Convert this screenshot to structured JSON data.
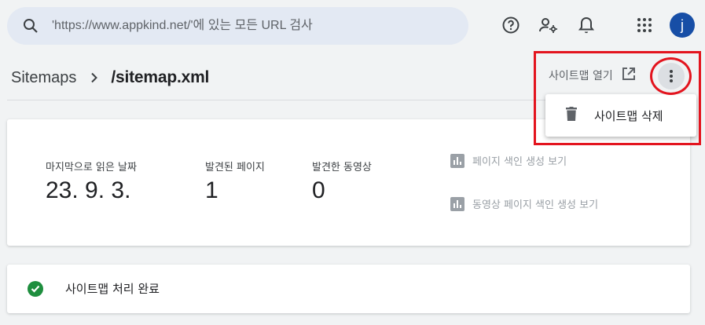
{
  "search": {
    "placeholder": "'https://www.appkind.net/'에 있는 모든 URL 검사"
  },
  "topbar": {
    "icons": [
      "help-icon",
      "manage-users-icon",
      "notifications-icon",
      "apps-grid-icon"
    ],
    "avatar_letter": "j",
    "avatar_color": "#174ea6"
  },
  "breadcrumb": {
    "root": "Sitemaps",
    "current": "/sitemap.xml"
  },
  "header_actions": {
    "open_sitemap_label": "사이트맵 열기"
  },
  "menu": {
    "delete_label": "사이트맵 삭제"
  },
  "stats": [
    {
      "label": "마지막으로 읽은 날짜",
      "value": "23. 9. 3."
    },
    {
      "label": "발견된 페이지",
      "value": "1"
    },
    {
      "label": "발견한 동영상",
      "value": "0"
    }
  ],
  "report_links": {
    "page_indexing": "페이지 색인 생성 보기",
    "video_indexing": "동영상 페이지 색인 생성 보기"
  },
  "status": {
    "text": "사이트맵 처리 완료",
    "color": "#1e8e3e"
  },
  "annotation_color": "#e3141e"
}
